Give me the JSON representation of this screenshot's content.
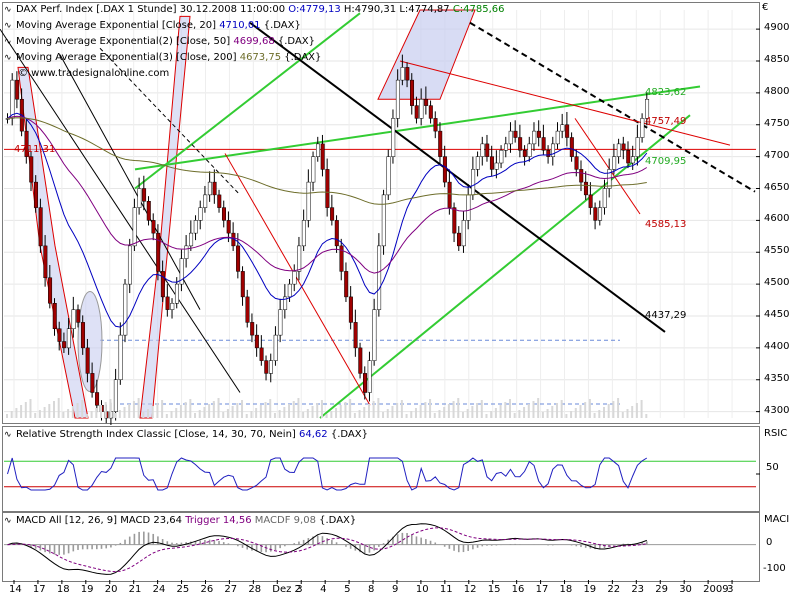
{
  "main_legend": {
    "title": "DAX Perf. Index [.DAX  1 Stunde]",
    "datetime": "30.12.2008 11:00:00",
    "o": "O:4779,13",
    "h": "H:4790,31",
    "l": "L:4774,87",
    "c": "C:4785,66",
    "ma1_label": "Moving Average Exponential [Close, 20]",
    "ma1_value": "4710,01",
    "ma1_suffix": "{.DAX}",
    "ma2_label": "Moving Average Exponential(2) [Close, 50]",
    "ma2_value": "4699,68",
    "ma2_suffix": "{.DAX}",
    "ma3_label": "Moving Average Exponential(3) [Close, 200]",
    "ma3_value": "4673,75",
    "ma3_suffix": "{.DAX}",
    "source": "© www.tradesignalonline.com"
  },
  "rsi_legend": {
    "label": "Relative Strength Index Classic [Close, 14, 30, 70, Nein]",
    "value": "64,62",
    "suffix": "{.DAX}"
  },
  "macd_legend": {
    "label": "MACD All [12, 26, 9] MACD",
    "macd_value": "23,64",
    "trigger_label": "Trigger",
    "trigger_value": "14,56",
    "macdf_label": "MACDF",
    "macdf_value": "9,08",
    "suffix": "{.DAX}"
  },
  "price_axis": {
    "currency": "€",
    "ticks": [
      "4900",
      "4850",
      "4800",
      "4750",
      "4700",
      "4650",
      "4600",
      "4550",
      "4500",
      "4450",
      "4400",
      "4350",
      "4300"
    ]
  },
  "rsi_axis": {
    "label": "RSIC",
    "ticks": [
      "50"
    ]
  },
  "macd_axis": {
    "label": "MACI",
    "ticks": [
      "0",
      "-100"
    ]
  },
  "x_axis": {
    "labels": [
      "14",
      "17",
      "18",
      "19",
      "20",
      "21",
      "24",
      "25",
      "26",
      "27",
      "28",
      "Dez 2",
      "3",
      "4",
      "5",
      "8",
      "9",
      "10",
      "11",
      "12",
      "15",
      "16",
      "17",
      "18",
      "19",
      "22",
      "23",
      "29",
      "30",
      "2009",
      "3"
    ]
  },
  "annotations": {
    "level_4823": "4823,62",
    "level_4757": "4757,49",
    "level_4711": "4711,31",
    "level_4709": "4709,95",
    "level_4585": "4585,13",
    "level_4437": "4437,29"
  },
  "colors": {
    "candle_up": "#ffffff",
    "candle_down": "#a00000",
    "ema20": "#0000c0",
    "ema50": "#800080",
    "ema200": "#6d6d2a",
    "trend_green": "#33cc33",
    "trend_red": "#dd0000",
    "trend_black": "#000000",
    "rsi_line": "#2020c0",
    "rsi_upper": "#33cc33",
    "rsi_lower": "#cc0000"
  },
  "chart_data": {
    "type": "candlestick",
    "yrange": [
      4290,
      4930
    ],
    "rsi_range": [
      0,
      100
    ],
    "rsi_levels": [
      30,
      70
    ],
    "macd_range": [
      -120,
      60
    ],
    "closes": [
      4760,
      4820,
      4790,
      4740,
      4700,
      4660,
      4620,
      4560,
      4510,
      4470,
      4430,
      4410,
      4400,
      4430,
      4460,
      4440,
      4400,
      4360,
      4330,
      4310,
      4300,
      4290,
      4300,
      4350,
      4420,
      4500,
      4560,
      4620,
      4650,
      4630,
      4600,
      4580,
      4520,
      4480,
      4460,
      4470,
      4500,
      4540,
      4560,
      4580,
      4600,
      4620,
      4640,
      4660,
      4640,
      4620,
      4600,
      4580,
      4560,
      4520,
      4480,
      4440,
      4420,
      4400,
      4380,
      4360,
      4380,
      4420,
      4460,
      4480,
      4500,
      4520,
      4560,
      4600,
      4660,
      4700,
      4720,
      4680,
      4620,
      4600,
      4560,
      4520,
      4480,
      4440,
      4400,
      4360,
      4330,
      4380,
      4460,
      4560,
      4640,
      4700,
      4760,
      4820,
      4840,
      4820,
      4780,
      4760,
      4790,
      4780,
      4760,
      4740,
      4700,
      4660,
      4620,
      4580,
      4560,
      4600,
      4640,
      4680,
      4700,
      4720,
      4700,
      4680,
      4690,
      4710,
      4720,
      4740,
      4730,
      4710,
      4700,
      4720,
      4740,
      4730,
      4710,
      4700,
      4720,
      4740,
      4750,
      4730,
      4700,
      4680,
      4660,
      4640,
      4620,
      4600,
      4620,
      4650,
      4680,
      4700,
      4720,
      4710,
      4690,
      4700,
      4730,
      4760,
      4790
    ]
  }
}
